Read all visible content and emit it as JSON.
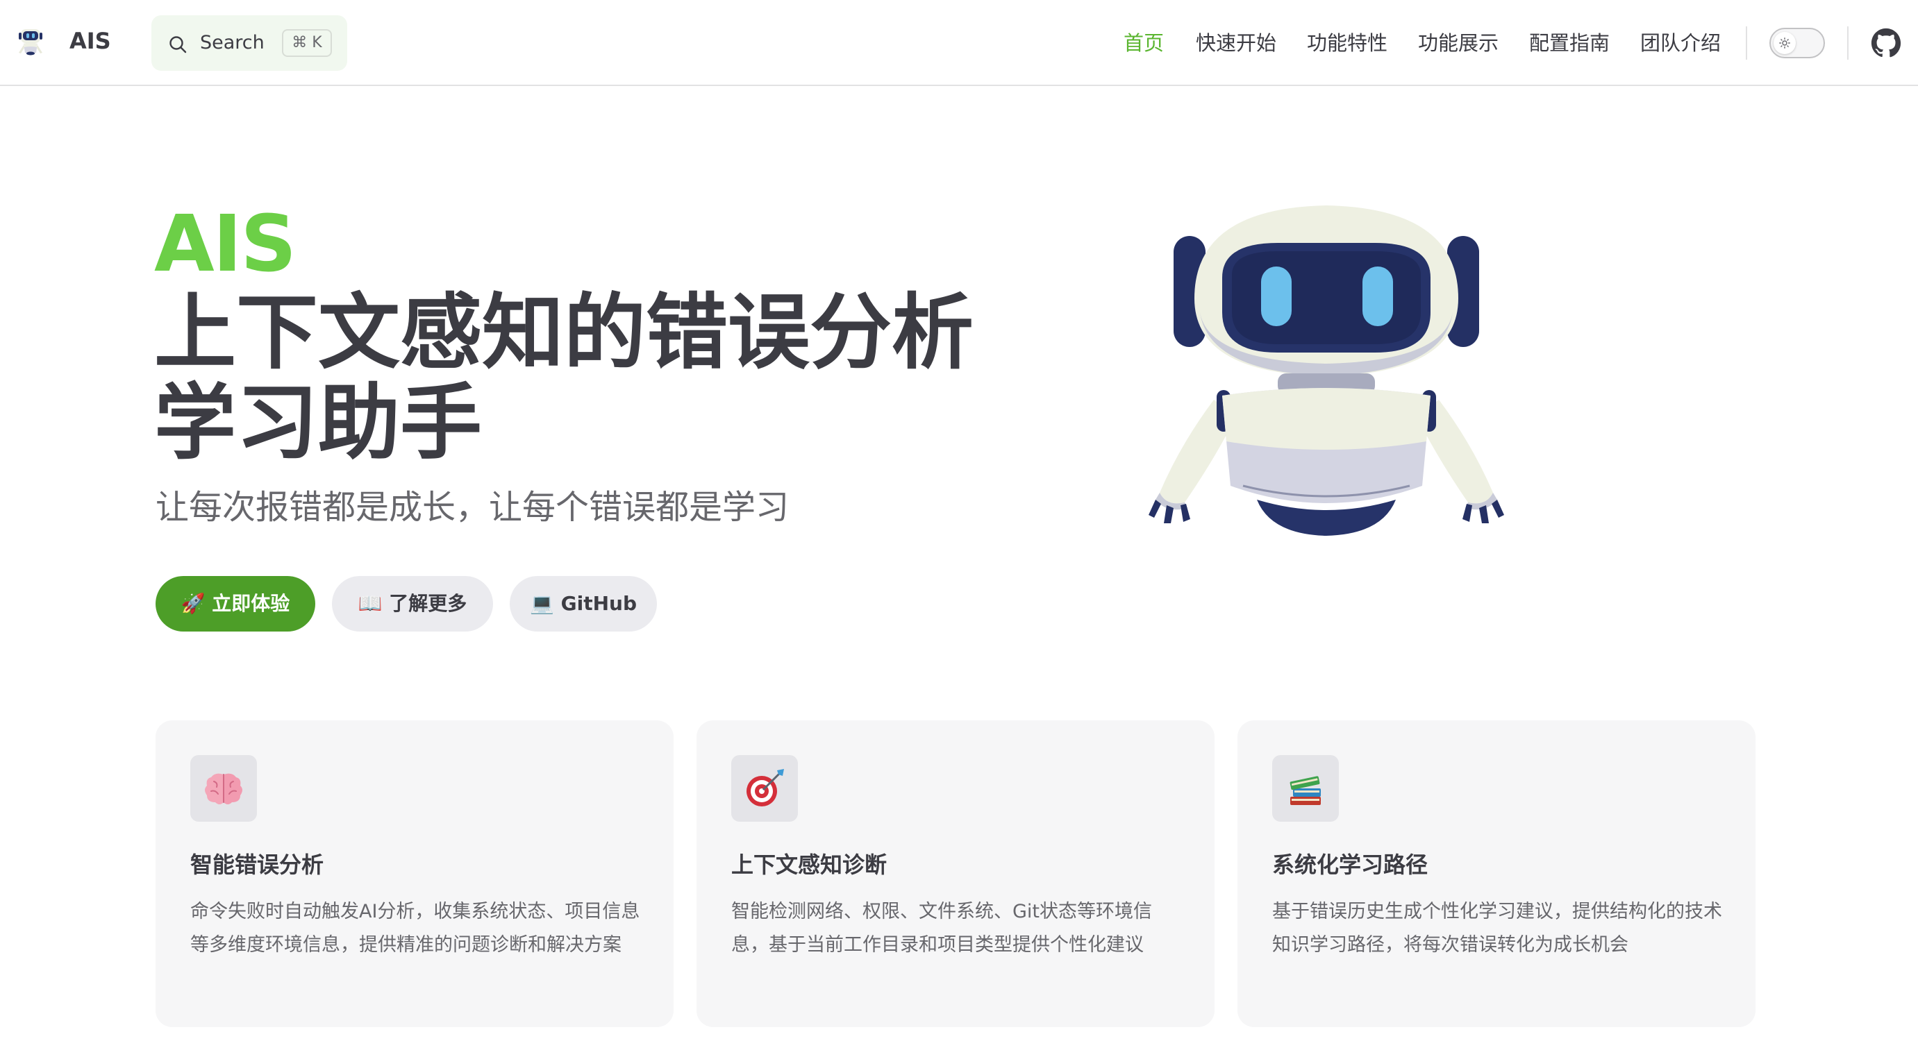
{
  "nav": {
    "brand": "AIS",
    "search_label": "Search",
    "search_shortcut": "⌘ K",
    "links": [
      {
        "label": "首页",
        "active": true
      },
      {
        "label": "快速开始",
        "active": false
      },
      {
        "label": "功能特性",
        "active": false
      },
      {
        "label": "功能展示",
        "active": false
      },
      {
        "label": "配置指南",
        "active": false
      },
      {
        "label": "团队介绍",
        "active": false
      }
    ],
    "icons": {
      "logo": "robot-logo-icon",
      "search": "search-icon",
      "theme": "sun-icon",
      "github": "github-icon"
    }
  },
  "hero": {
    "name": "AIS",
    "title_line1": "上下文感知的错误分析",
    "title_line2": "学习助手",
    "tagline": "让每次报错都是成长，让每个错误都是学习",
    "buttons": {
      "primary": "🚀 立即体验",
      "learn_more": "📖 了解更多",
      "github": "💻 GitHub"
    },
    "image": "robot-mascot"
  },
  "features": [
    {
      "icon": "brain-icon",
      "title": "智能错误分析",
      "desc": "命令失败时自动触发AI分析，收集系统状态、项目信息等多维度环境信息，提供精准的问题诊断和解决方案"
    },
    {
      "icon": "target-icon",
      "title": "上下文感知诊断",
      "desc": "智能检测网络、权限、文件系统、Git状态等环境信息，基于当前工作目录和项目类型提供个性化建议"
    },
    {
      "icon": "books-icon",
      "title": "系统化学习路径",
      "desc": "基于错误历史生成个性化学习建议，提供结构化的技术知识学习路径，将每次错误转化为成长机会"
    }
  ],
  "colors": {
    "brand_green": "#6ccf47",
    "primary_button": "#4d9e28",
    "active_link": "#5ab52f",
    "text": "#3c3c43",
    "muted": "#67676c",
    "card_bg": "#f6f6f7"
  }
}
